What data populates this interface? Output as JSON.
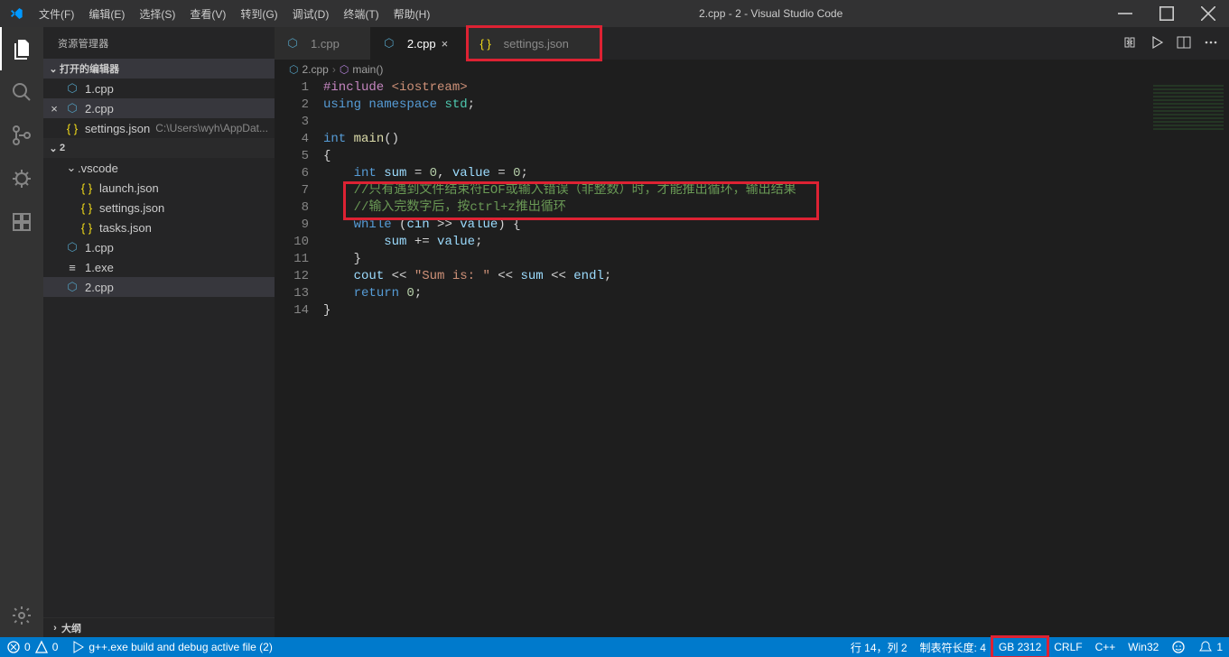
{
  "menus": [
    "文件(F)",
    "编辑(E)",
    "选择(S)",
    "查看(V)",
    "转到(G)",
    "调试(D)",
    "终端(T)",
    "帮助(H)"
  ],
  "window_title": "2.cpp - 2 - Visual Studio Code",
  "sidebar": {
    "title": "资源管理器",
    "open_editors_label": "打开的编辑器",
    "open_editors": [
      {
        "name": "1.cpp",
        "icon": "cpp"
      },
      {
        "name": "2.cpp",
        "icon": "cpp",
        "active": true,
        "close": true
      },
      {
        "name": "settings.json",
        "icon": "json",
        "path": "C:\\Users\\wyh\\AppDat..."
      }
    ],
    "workspace_label": "2",
    "vscode_folder": ".vscode",
    "vscode_files": [
      {
        "name": "launch.json",
        "icon": "json"
      },
      {
        "name": "settings.json",
        "icon": "json"
      },
      {
        "name": "tasks.json",
        "icon": "json"
      }
    ],
    "root_files": [
      {
        "name": "1.cpp",
        "icon": "cpp"
      },
      {
        "name": "1.exe",
        "icon": "exe"
      },
      {
        "name": "2.cpp",
        "icon": "cpp",
        "active": true
      }
    ],
    "outline_label": "大纲"
  },
  "tabs": [
    {
      "name": "1.cpp",
      "icon": "cpp"
    },
    {
      "name": "2.cpp",
      "icon": "cpp",
      "active": true
    },
    {
      "name": "settings.json",
      "icon": "json",
      "highlight": true
    }
  ],
  "breadcrumb": {
    "file": "2.cpp",
    "symbol": "main()"
  },
  "code": {
    "lines": [
      {
        "n": 1,
        "seg": [
          [
            "pp",
            "#include "
          ],
          [
            "str",
            "<iostream>"
          ]
        ]
      },
      {
        "n": 2,
        "seg": [
          [
            "kw",
            "using "
          ],
          [
            "kw",
            "namespace "
          ],
          [
            "ns",
            "std"
          ],
          [
            "op",
            ";"
          ]
        ]
      },
      {
        "n": 3,
        "seg": [
          [
            "op",
            ""
          ]
        ]
      },
      {
        "n": 4,
        "seg": [
          [
            "type",
            "int "
          ],
          [
            "fn",
            "main"
          ],
          [
            "op",
            "()"
          ]
        ]
      },
      {
        "n": 5,
        "seg": [
          [
            "op",
            "{"
          ]
        ]
      },
      {
        "n": 6,
        "seg": [
          [
            "op",
            "    "
          ],
          [
            "type",
            "int "
          ],
          [
            "var",
            "sum"
          ],
          [
            "op",
            " = "
          ],
          [
            "num",
            "0"
          ],
          [
            "op",
            ", "
          ],
          [
            "var",
            "value"
          ],
          [
            "op",
            " = "
          ],
          [
            "num",
            "0"
          ],
          [
            "op",
            ";"
          ]
        ]
      },
      {
        "n": 7,
        "seg": [
          [
            "op",
            "    "
          ],
          [
            "cmt",
            "//只有遇到文件结束符EOF或输入错误（非整数）时，才能推出循环，输出结果"
          ]
        ]
      },
      {
        "n": 8,
        "seg": [
          [
            "op",
            "    "
          ],
          [
            "cmt",
            "//输入完数字后，按ctrl+z推出循环"
          ]
        ]
      },
      {
        "n": 9,
        "seg": [
          [
            "op",
            "    "
          ],
          [
            "kw",
            "while"
          ],
          [
            "op",
            " ("
          ],
          [
            "var",
            "cin"
          ],
          [
            "op",
            " >> "
          ],
          [
            "var",
            "value"
          ],
          [
            "op",
            ") {"
          ]
        ]
      },
      {
        "n": 10,
        "seg": [
          [
            "op",
            "        "
          ],
          [
            "var",
            "sum"
          ],
          [
            "op",
            " += "
          ],
          [
            "var",
            "value"
          ],
          [
            "op",
            ";"
          ]
        ]
      },
      {
        "n": 11,
        "seg": [
          [
            "op",
            "    }"
          ]
        ]
      },
      {
        "n": 12,
        "seg": [
          [
            "op",
            "    "
          ],
          [
            "var",
            "cout"
          ],
          [
            "op",
            " << "
          ],
          [
            "str",
            "\"Sum is: \""
          ],
          [
            "op",
            " << "
          ],
          [
            "var",
            "sum"
          ],
          [
            "op",
            " << "
          ],
          [
            "var",
            "endl"
          ],
          [
            "op",
            ";"
          ]
        ]
      },
      {
        "n": 13,
        "seg": [
          [
            "op",
            "    "
          ],
          [
            "kw",
            "return "
          ],
          [
            "num",
            "0"
          ],
          [
            "op",
            ";"
          ]
        ]
      },
      {
        "n": 14,
        "seg": [
          [
            "op",
            "}"
          ]
        ]
      }
    ]
  },
  "statusbar": {
    "errors": "0",
    "warnings": "0",
    "build_task": "g++.exe build and debug active file (2)",
    "cursor": "行 14，列 2",
    "tabsize": "制表符长度: 4",
    "encoding": "GB 2312",
    "eol": "CRLF",
    "language": "C++",
    "platform": "Win32",
    "feedback": "",
    "notifications": "1"
  }
}
